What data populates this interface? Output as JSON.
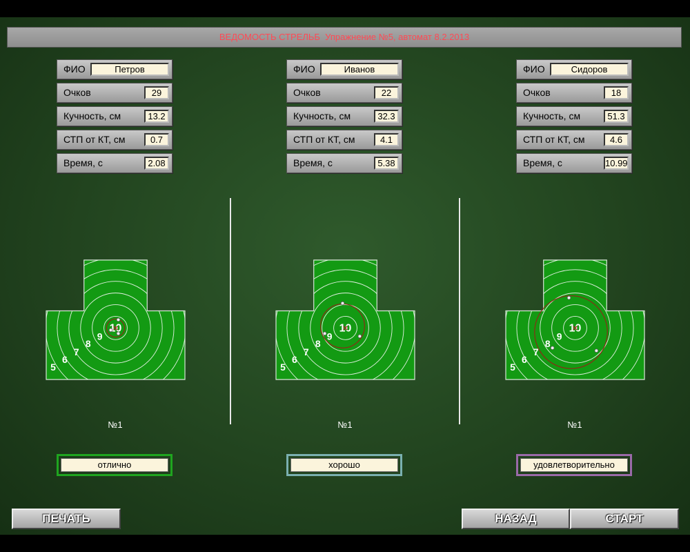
{
  "header": {
    "title": "ВЕДОМОСТЬ СТРЕЛЬБ  Упражнение №5, автомат 8.2.2013"
  },
  "field_labels": {
    "fio": "ФИО",
    "score": "Очков",
    "grouping": "Кучность, см",
    "stp": "СТП от КТ, см",
    "time": "Время, с"
  },
  "shooters": [
    {
      "name": "Петров",
      "score": "29",
      "grouping": "13.2",
      "stp": "0.7",
      "time": "2.08",
      "target_label": "№1",
      "grade": "отлично",
      "grade_color": "#1fa51f",
      "group_circle": {
        "cx": 0.0,
        "cy": 0.0,
        "r": 13.2
      },
      "hits": [
        {
          "x": 4,
          "y": 12
        },
        {
          "x": -7,
          "y": -3
        },
        {
          "x": 4,
          "y": -8
        }
      ]
    },
    {
      "name": "Иванов",
      "score": "22",
      "grouping": "32.3",
      "stp": "4.1",
      "time": "5.38",
      "target_label": "№1",
      "grade": "хорошо",
      "grade_color": "#7ab0b0",
      "group_circle": {
        "cx": -4.0,
        "cy": 3.0,
        "r": 32.0
      },
      "hits": [
        {
          "x": -4,
          "y": 36
        },
        {
          "x": -30,
          "y": -8
        },
        {
          "x": 21,
          "y": -12
        }
      ]
    },
    {
      "name": "Сидоров",
      "score": "18",
      "grouping": "51.3",
      "stp": "4.6",
      "time": "10.99",
      "target_label": "№1",
      "grade": "удовлетворительно",
      "grade_color": "#9a6aa8",
      "group_circle": {
        "cx": -6.0,
        "cy": -6.0,
        "r": 53.0
      },
      "hits": [
        {
          "x": -9,
          "y": 44
        },
        {
          "x": -33,
          "y": -29
        },
        {
          "x": 31,
          "y": -33
        }
      ]
    }
  ],
  "target": {
    "ring_numbers": [
      "10",
      "9",
      "8",
      "7",
      "6",
      "5"
    ],
    "color": "#139a13"
  },
  "buttons": {
    "print": "ПЕЧАТЬ",
    "back": "НАЗАД",
    "start": "СТАРТ"
  }
}
